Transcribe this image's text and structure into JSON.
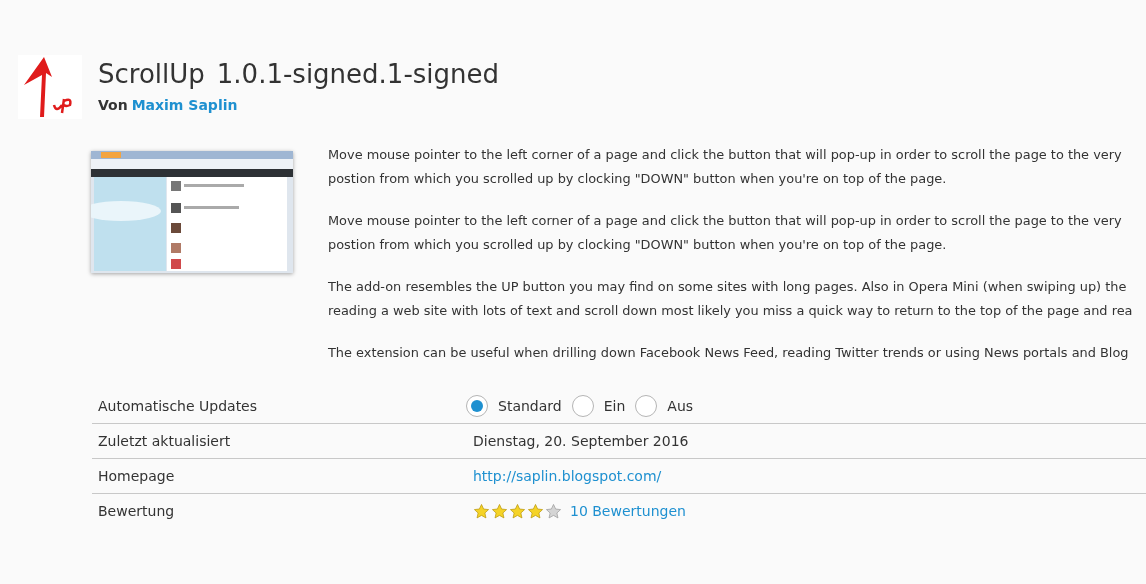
{
  "addon": {
    "name": "ScrollUp",
    "version": "1.0.1-signed.1-signed",
    "author_prefix": "Von",
    "author": "Maxim Saplin"
  },
  "description": [
    {
      "lines": [
        "Move mouse pointer to the left corner of a page and click the button that will pop-up in order to scroll the page to the very",
        "postion from which you scrolled up by clocking \"DOWN\" button when you're on top of the page."
      ]
    },
    {
      "lines": [
        "Move mouse pointer to the left corner of a page and click the button that will pop-up in order to scroll the page to the very",
        "postion from which you scrolled up by clocking \"DOWN\" button when you're on top of the page."
      ]
    },
    {
      "lines": [
        "The add-on resembles the UP button you may find on some sites with long pages. Also in Opera Mini (when swiping up) the",
        "reading a web site with lots of text and scroll down most likely you miss a quick way to return to the top of the page and rea"
      ]
    },
    {
      "lines": [
        "The extension can be useful when drilling down Facebook News Feed, reading Twitter trends or using News portals and Blog"
      ]
    }
  ],
  "details": [
    {
      "kind": "radios",
      "label": "Automatische Updates",
      "options": [
        {
          "label": "Standard",
          "selected": true
        },
        {
          "label": "Ein",
          "selected": false
        },
        {
          "label": "Aus",
          "selected": false
        }
      ]
    },
    {
      "kind": "text",
      "label": "Zuletzt aktualisiert",
      "value": "Dienstag, 20. September 2016"
    },
    {
      "kind": "link",
      "label": "Homepage",
      "value": "http://saplin.blogspot.com/"
    },
    {
      "kind": "rating",
      "label": "Bewertung",
      "stars": 4,
      "value": "10 Bewertungen"
    }
  ]
}
